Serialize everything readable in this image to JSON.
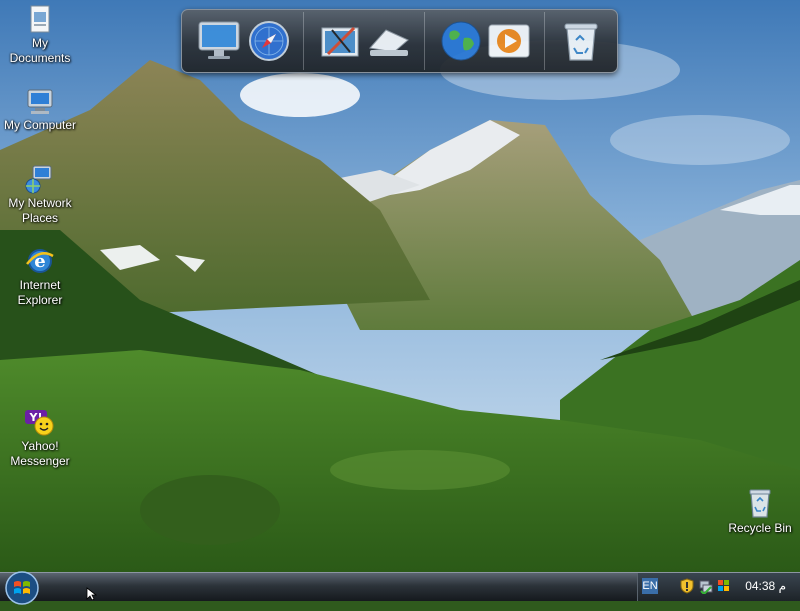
{
  "desktop": {
    "icons": [
      {
        "label": "My\nDocuments",
        "icon": "folder-documents-icon"
      },
      {
        "label": "My Computer",
        "icon": "computer-icon"
      },
      {
        "label": "My Network\nPlaces",
        "icon": "network-places-icon"
      },
      {
        "label": "Internet\nExplorer",
        "icon": "internet-explorer-icon"
      },
      {
        "label": "Yahoo!\nMessenger",
        "icon": "yahoo-messenger-icon"
      },
      {
        "label": "Recycle Bin",
        "icon": "recycle-bin-icon"
      }
    ]
  },
  "dock": {
    "items": [
      "monitor-icon",
      "safari-compass-icon",
      "graphics-tools-icon",
      "eject-icon",
      "globe-icon",
      "media-player-icon",
      "trash-icon"
    ]
  },
  "taskbar": {
    "language": "EN",
    "clock": "04:38 م",
    "tray_icons": [
      "security-shield-icon",
      "network-tray-icon",
      "windows-flag-tray-icon"
    ]
  },
  "colors": {
    "sky": "#6f9fcf",
    "grass": "#3f7a22",
    "taskbar": "#2c333a",
    "accent": "#3a6ea8"
  }
}
